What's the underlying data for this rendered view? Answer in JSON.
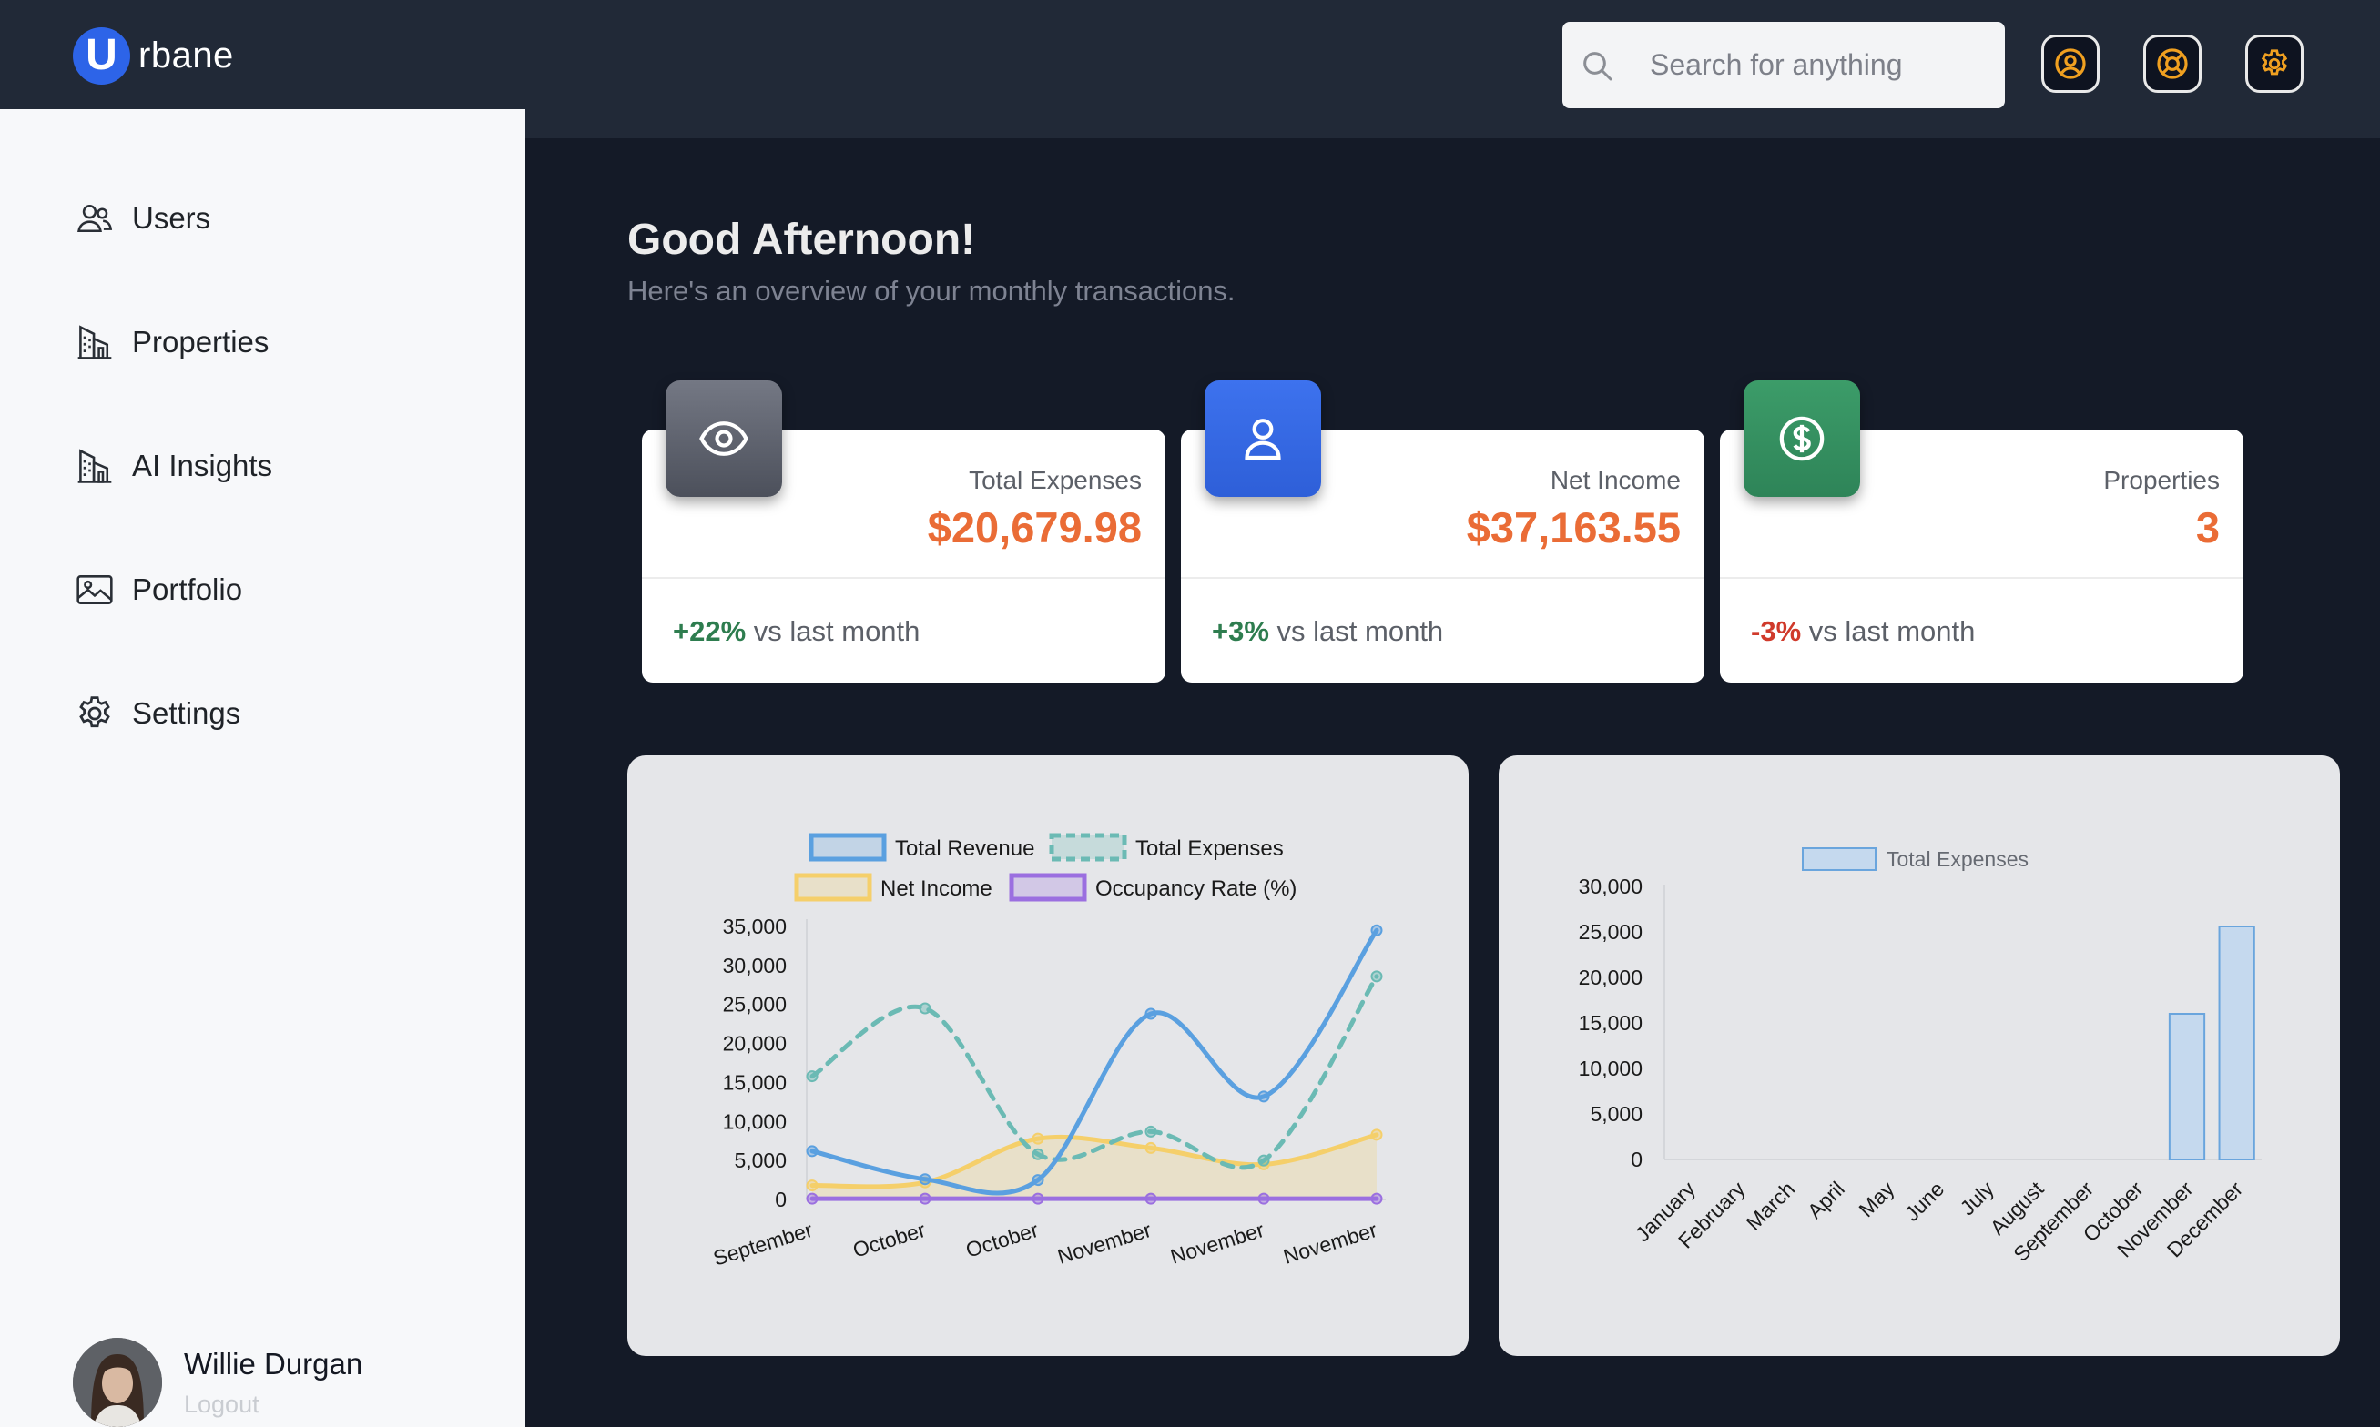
{
  "app": {
    "logo_letter": "U",
    "logo_text": "rbane"
  },
  "header": {
    "search_placeholder": "Search for anything",
    "buttons": [
      "user-circle-icon",
      "lifebuoy-icon",
      "gear-icon"
    ],
    "accent_color": "#f0a020"
  },
  "sidebar": {
    "items": [
      {
        "label": "Users",
        "icon": "users-icon"
      },
      {
        "label": "Properties",
        "icon": "building-icon"
      },
      {
        "label": "AI Insights",
        "icon": "building-icon"
      },
      {
        "label": "Portfolio",
        "icon": "image-icon"
      },
      {
        "label": "Settings",
        "icon": "gear-icon"
      }
    ],
    "user": {
      "name": "Willie Durgan",
      "logout_label": "Logout"
    }
  },
  "main": {
    "greeting": "Good Afternoon!",
    "subtitle": "Here's an overview of your monthly transactions."
  },
  "cards": [
    {
      "title": "Total Expenses",
      "value": "$20,679.98",
      "change": "+22%",
      "change_text": "vs last month",
      "change_color": "#2e7d4f",
      "icon": "eye-icon",
      "icon_color": "#5b5f6b"
    },
    {
      "title": "Net Income",
      "value": "$37,163.55",
      "change": "+3%",
      "change_text": "vs last month",
      "change_color": "#2e7d4f",
      "icon": "user-icon",
      "icon_color": "#2d64e8"
    },
    {
      "title": "Properties",
      "value": "3",
      "change": "-3%",
      "change_text": "vs last month",
      "change_color": "#d03a2b",
      "icon": "dollar-icon",
      "icon_color": "#2f8a5b"
    }
  ],
  "chart_data": [
    {
      "type": "line",
      "x": [
        "September",
        "October",
        "October",
        "November",
        "November",
        "November"
      ],
      "series": [
        {
          "name": "Total Revenue",
          "values": [
            6200,
            2600,
            2500,
            23800,
            13200,
            34500
          ],
          "color": "#5aa0e0"
        },
        {
          "name": "Total Expenses",
          "values": [
            15800,
            24500,
            5800,
            8700,
            5000,
            28600
          ],
          "color": "#6bbab4",
          "dashed": true
        },
        {
          "name": "Net Income",
          "values": [
            1800,
            2200,
            7800,
            6600,
            4500,
            8300
          ],
          "color": "#f5cf6a"
        },
        {
          "name": "Occupancy Rate (%)",
          "values": [
            100,
            100,
            100,
            100,
            100,
            100
          ],
          "color": "#9b6fe0"
        }
      ],
      "ylim": [
        0,
        35000
      ],
      "yticks": [
        "35,000",
        "30,000",
        "25,000",
        "20,000",
        "15,000",
        "10,000",
        "5,000",
        "0"
      ],
      "legend_position": "top"
    },
    {
      "type": "bar",
      "categories": [
        "January",
        "February",
        "March",
        "April",
        "May",
        "June",
        "July",
        "August",
        "September",
        "October",
        "November",
        "December"
      ],
      "series": [
        {
          "name": "Total Expenses",
          "values": [
            0,
            0,
            0,
            0,
            0,
            0,
            0,
            0,
            0,
            0,
            16000,
            25600
          ],
          "color": "#c5d9ee",
          "border": "#6aa5dd"
        }
      ],
      "ylim": [
        0,
        30000
      ],
      "yticks": [
        "30,000",
        "25,000",
        "20,000",
        "15,000",
        "10,000",
        "5,000",
        "0"
      ],
      "legend_position": "top"
    }
  ]
}
